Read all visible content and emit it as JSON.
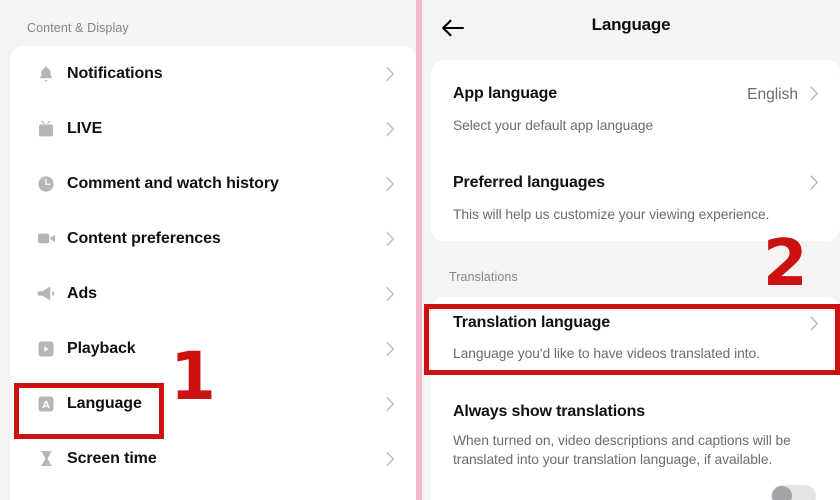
{
  "left_panel": {
    "section_label": "Content & Display",
    "items": [
      {
        "label": "Notifications",
        "icon": "bell-icon"
      },
      {
        "label": "LIVE",
        "icon": "live-tv-icon"
      },
      {
        "label": "Comment and watch history",
        "icon": "clock-icon"
      },
      {
        "label": "Content preferences",
        "icon": "video-camera-icon"
      },
      {
        "label": "Ads",
        "icon": "megaphone-icon"
      },
      {
        "label": "Playback",
        "icon": "play-square-icon"
      },
      {
        "label": "Language",
        "icon": "letter-a-icon"
      },
      {
        "label": "Screen time",
        "icon": "hourglass-icon"
      }
    ],
    "chevron_icon": "chevron-right-icon"
  },
  "right_panel": {
    "header": {
      "back_icon": "back-arrow-icon",
      "title": "Language"
    },
    "card_one": [
      {
        "title": "App language",
        "value": "English",
        "subtitle": "Select your default app language",
        "chevron_icon": "chevron-right-icon"
      },
      {
        "title": "Preferred languages",
        "value": "",
        "subtitle": "This will help us customize your viewing experience.",
        "chevron_icon": "chevron-right-icon"
      }
    ],
    "translations_label": "Translations",
    "card_two": [
      {
        "title": "Translation language",
        "subtitle": "Language you'd like to have videos translated into.",
        "chevron_icon": "chevron-right-icon"
      },
      {
        "title": "Always show translations",
        "subtitle": "When turned on, video descriptions and captions will be translated into your translation language, if available.",
        "toggle_state": "off"
      }
    ]
  },
  "annotations": {
    "step_one": "1",
    "step_two": "2",
    "highlight_color": "#cc1111"
  }
}
